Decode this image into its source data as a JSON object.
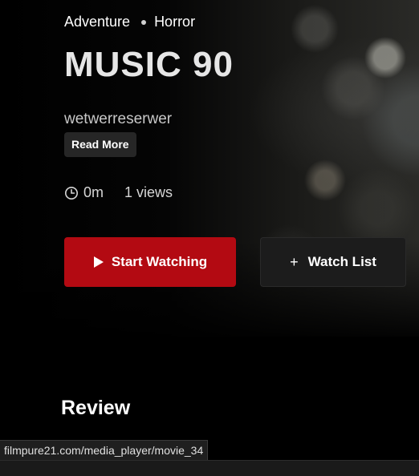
{
  "movie": {
    "genres": [
      "Adventure",
      "Horror"
    ],
    "title": "MUSIC 90",
    "description": "wetwerreserwer",
    "read_more_label": "Read More",
    "duration": "0m",
    "views": "1 views"
  },
  "actions": {
    "start_watching_label": "Start Watching",
    "watch_list_label": "Watch List",
    "start_watching_color": "#b30a12"
  },
  "sections": {
    "review_heading": "Review"
  },
  "status_bar": {
    "url": "filmpure21.com/media_player/movie_34"
  },
  "icons": {
    "clock": "clock-icon",
    "play": "play-icon",
    "plus": "plus-icon"
  }
}
